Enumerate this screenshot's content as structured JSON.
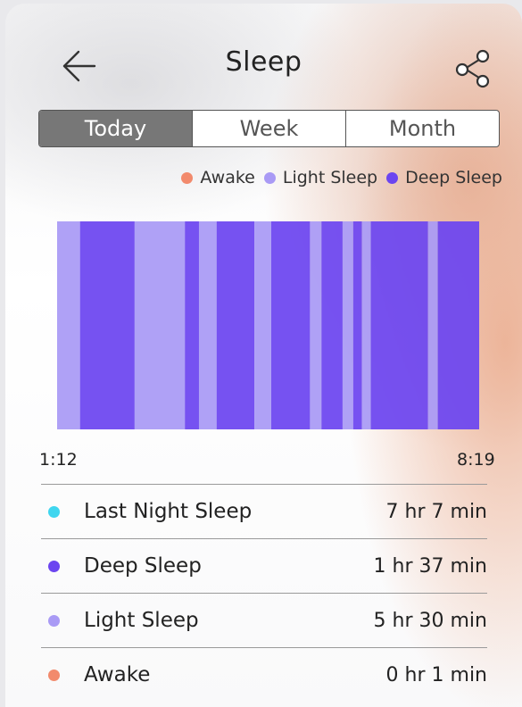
{
  "header": {
    "title": "Sleep",
    "back_icon": "arrow-left-icon",
    "share_icon": "share-icon"
  },
  "tabs": [
    {
      "label": "Today",
      "active": true
    },
    {
      "label": "Week",
      "active": false
    },
    {
      "label": "Month",
      "active": false
    }
  ],
  "legend": [
    {
      "label": "Awake",
      "color": "#f28a6c"
    },
    {
      "label": "Light Sleep",
      "color": "#a99af5"
    },
    {
      "label": "Deep Sleep",
      "color": "#6c45f0"
    }
  ],
  "chart_data": {
    "type": "bar",
    "description": "sleep stage timeline",
    "start_time": "1:12",
    "end_time": "8:19",
    "segments": [
      {
        "stage": "Light Sleep",
        "minutes": 26
      },
      {
        "stage": "Deep Sleep",
        "minutes": 62
      },
      {
        "stage": "Light Sleep",
        "minutes": 57
      },
      {
        "stage": "Deep Sleep",
        "minutes": 16
      },
      {
        "stage": "Light Sleep",
        "minutes": 20
      },
      {
        "stage": "Deep Sleep",
        "minutes": 43
      },
      {
        "stage": "Light Sleep",
        "minutes": 19
      },
      {
        "stage": "Deep Sleep",
        "minutes": 44
      },
      {
        "stage": "Light Sleep",
        "minutes": 13
      },
      {
        "stage": "Deep Sleep",
        "minutes": 24
      },
      {
        "stage": "Light Sleep",
        "minutes": 12
      },
      {
        "stage": "Deep Sleep",
        "minutes": 10
      },
      {
        "stage": "Light Sleep",
        "minutes": 10
      },
      {
        "stage": "Deep Sleep",
        "minutes": 65
      },
      {
        "stage": "Light Sleep",
        "minutes": 11
      },
      {
        "stage": "Deep Sleep",
        "minutes": 47
      }
    ]
  },
  "stats": [
    {
      "label": "Last Night Sleep",
      "value": "7 hr 7 min",
      "color": "#3fd6ef"
    },
    {
      "label": "Deep Sleep",
      "value": "1 hr 37 min",
      "color": "#6c45f0"
    },
    {
      "label": "Light Sleep",
      "value": "5 hr 30 min",
      "color": "#a99af5"
    },
    {
      "label": "Awake",
      "value": "0 hr 1 min",
      "color": "#f28a6c"
    }
  ]
}
